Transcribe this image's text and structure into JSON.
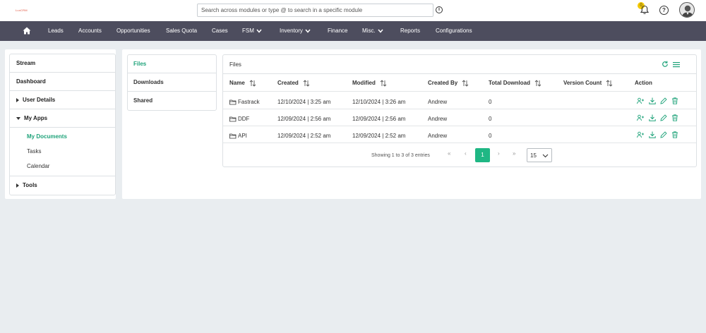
{
  "brand": {
    "logo_text": "LuxCRM"
  },
  "search": {
    "placeholder": "Search across modules or type @ to search in a specific module"
  },
  "header": {
    "notification_count": "0"
  },
  "nav": {
    "items": [
      "Leads",
      "Accounts",
      "Opportunities",
      "Sales Quota",
      "Cases",
      "FSM",
      "Inventory",
      "Finance",
      "Misc.",
      "Reports",
      "Configurations"
    ]
  },
  "sidebar": {
    "stream": "Stream",
    "dashboard": "Dashboard",
    "user_details": "User Details",
    "my_apps": "My Apps",
    "sub_items": [
      "My Documents",
      "Tasks",
      "Calendar"
    ],
    "tools": "Tools"
  },
  "tabs": [
    "Files",
    "Downloads",
    "Shared"
  ],
  "files": {
    "title": "Files",
    "columns": [
      "Name",
      "Created",
      "Modified",
      "Created By",
      "Total Download",
      "Version Count",
      "Action"
    ],
    "rows": [
      {
        "name": "Fastrack",
        "created": "12/10/2024 | 3:25 am",
        "modified": "12/10/2024 | 3:26 am",
        "created_by": "Andrew",
        "downloads": "0",
        "versions": ""
      },
      {
        "name": "DDF",
        "created": "12/09/2024 | 2:56 am",
        "modified": "12/09/2024 | 2:56 am",
        "created_by": "Andrew",
        "downloads": "0",
        "versions": ""
      },
      {
        "name": "API",
        "created": "12/09/2024 | 2:52 am",
        "modified": "12/09/2024 | 2:52 am",
        "created_by": "Andrew",
        "downloads": "0",
        "versions": ""
      }
    ],
    "pagination": {
      "summary": "Showing 1 to 3 of 3 entries",
      "current_page": "1",
      "page_size": "15"
    }
  },
  "colors": {
    "accent": "#1fa37a",
    "nav_bg": "#4d4d5e",
    "page_bg": "#e9edf0"
  }
}
